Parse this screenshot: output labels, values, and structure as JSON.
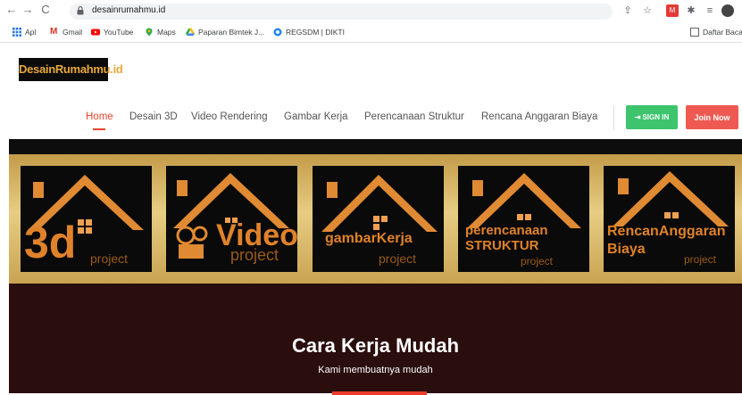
{
  "browser": {
    "url": "desainrumahmu.id",
    "bookmarks": [
      "Apl",
      "Gmail",
      "YouTube",
      "Maps",
      "Paparan Bimtek J...",
      "REGSDM | DIKTI"
    ],
    "reading_list": "Daftar Baca"
  },
  "site": {
    "logo": "DesainRumahmu.id",
    "menu": [
      "Home",
      "Desain 3D",
      "Video Rendering",
      "Gambar Kerja",
      "Perencanaan Struktur",
      "Rencana Anggaran Biaya"
    ],
    "signin": "SIGN IN",
    "join": "Join Now"
  },
  "panels": [
    {
      "big": "3d",
      "sub": "project"
    },
    {
      "big": "Video",
      "sub": "project"
    },
    {
      "big": "gambarKerja",
      "sub": "project"
    },
    {
      "big": "perencanaan STRUKTUR",
      "sub": "project"
    },
    {
      "big": "RencanAnggaran Biaya",
      "sub": "project"
    }
  ],
  "hero": {
    "title": "Cara Kerja Mudah",
    "subtitle": "Kami membuatnya mudah"
  },
  "colors": {
    "accent": "#e8452c",
    "signin": "#3ec46d",
    "join": "#ee5a52",
    "hero_bg": "#2a0d0d",
    "gold": "#d8b567"
  }
}
